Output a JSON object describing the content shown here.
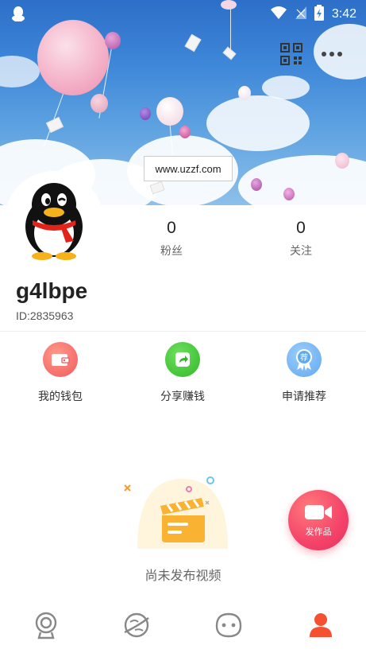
{
  "status_bar": {
    "time": "3:42",
    "icons": [
      "qq-notification-icon",
      "wifi-icon",
      "no-signal-icon",
      "battery-charging-icon"
    ]
  },
  "header": {
    "watermark": "www.uzzf.com",
    "actions": [
      "qr-code-icon",
      "more-icon"
    ]
  },
  "profile": {
    "avatar": "qq-penguin-avatar",
    "username": "g4lbpe",
    "user_id": "ID:2835963",
    "stats": [
      {
        "value": "0",
        "label": "粉丝"
      },
      {
        "value": "0",
        "label": "关注"
      }
    ]
  },
  "actions": [
    {
      "label": "我的钱包",
      "icon": "wallet-icon",
      "color": "#f7676a"
    },
    {
      "label": "分享赚钱",
      "icon": "share-icon",
      "color": "#3ec932"
    },
    {
      "label": "申请推荐",
      "icon": "recommend-badge-icon",
      "color": "#5fa9f2",
      "badge_text": "荐"
    }
  ],
  "empty_state": {
    "text": "尚未发布视频",
    "icon": "clapperboard-icon"
  },
  "fab": {
    "label": "发作品",
    "icon": "video-camera-icon"
  },
  "bottom_nav": [
    {
      "name": "camera",
      "icon": "webcam-icon",
      "active": false
    },
    {
      "name": "discover",
      "icon": "planet-icon",
      "active": false
    },
    {
      "name": "messages",
      "icon": "face-icon",
      "active": false
    },
    {
      "name": "me",
      "icon": "person-icon",
      "active": true
    }
  ],
  "colors": {
    "accent": "#f4436a",
    "active_nav": "#f5502f"
  }
}
